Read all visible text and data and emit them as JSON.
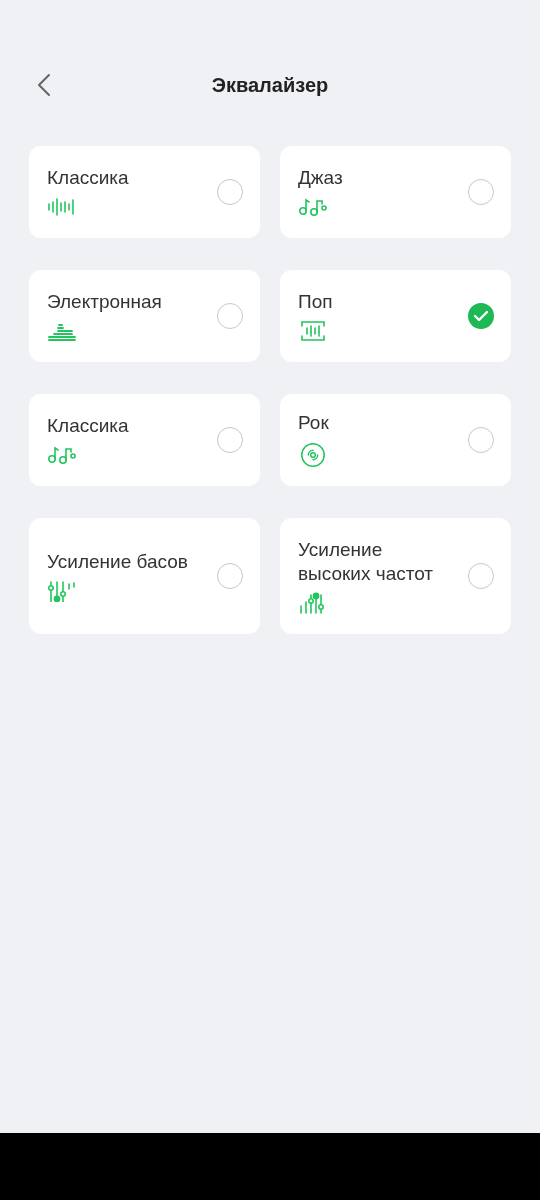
{
  "header": {
    "title": "Эквалайзер"
  },
  "presets": [
    {
      "label": "Классика",
      "selected": false
    },
    {
      "label": "Джаз",
      "selected": false
    },
    {
      "label": "Электронная",
      "selected": false
    },
    {
      "label": "Поп",
      "selected": true
    },
    {
      "label": "Классика",
      "selected": false
    },
    {
      "label": "Рок",
      "selected": false
    },
    {
      "label": "Усиление басов",
      "selected": false
    },
    {
      "label": "Усиление высоких частот",
      "selected": false
    }
  ]
}
